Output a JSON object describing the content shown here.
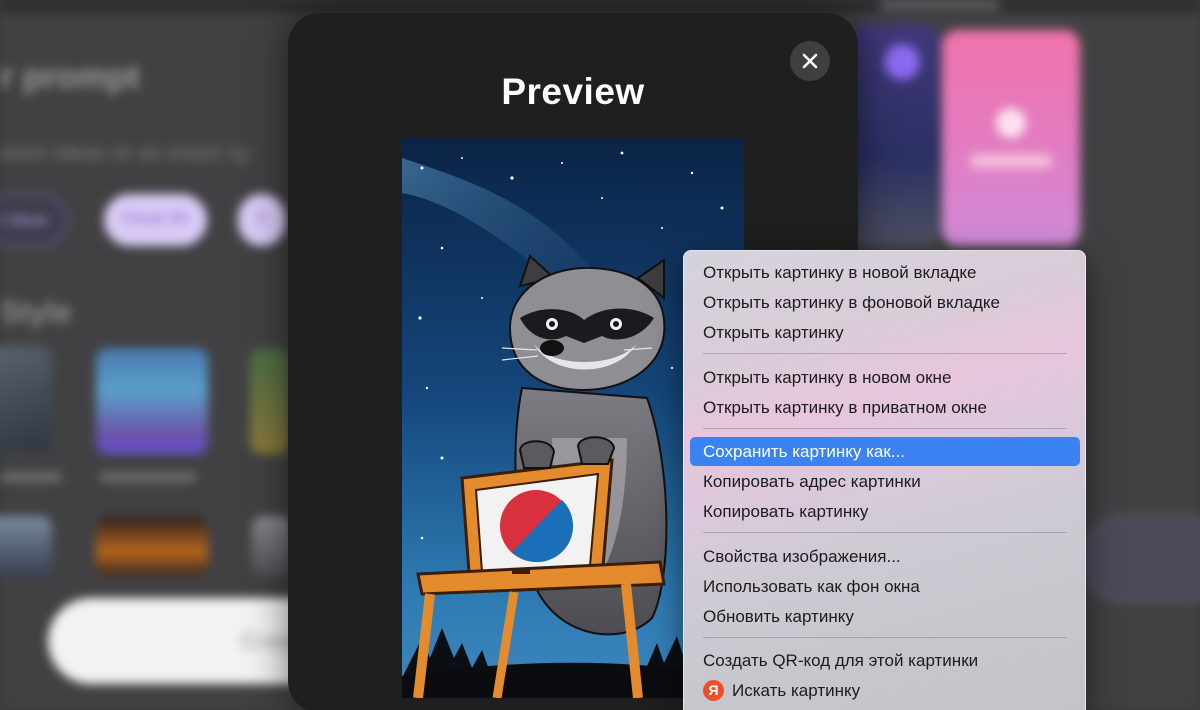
{
  "background": {
    "title": "r prompt",
    "subtitle": "ason ideas or an exact sy",
    "chips": [
      "t Ideas",
      "Cloud 3D",
      "C"
    ],
    "style_heading": "Style",
    "create_label": "Create"
  },
  "modal": {
    "title": "Preview",
    "close_icon": "close-icon"
  },
  "context_menu": {
    "items": [
      "Открыть картинку в новой вкладке",
      "Открыть картинку в фоновой вкладке",
      "Открыть картинку",
      "Открыть картинку в новом окне",
      "Открыть картинку в приватном окне",
      "Сохранить картинку как...",
      "Копировать адрес картинки",
      "Копировать картинку",
      "Свойства изображения...",
      "Использовать как фон окна",
      "Обновить картинку",
      "Создать QR-код для этой картинки",
      "Искать картинку"
    ],
    "highlighted_item": "Сохранить картинку как...",
    "search_icon_letter": "Я",
    "highlight_color": "#3b83f2"
  }
}
